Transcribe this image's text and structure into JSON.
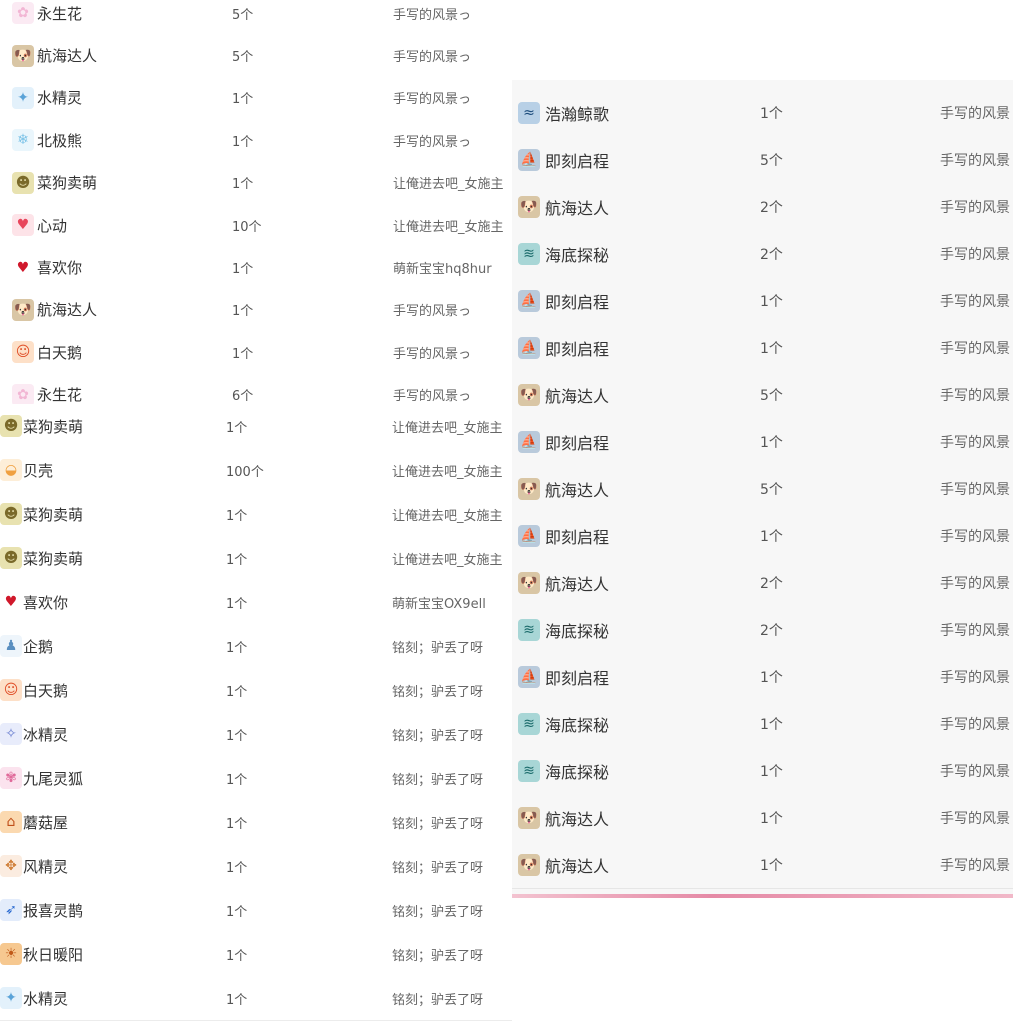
{
  "icons": {
    "永生花": {
      "glyph": "✿",
      "color": "#f2b6d4",
      "bg": "#fbeaf3",
      "name": "flower-icon"
    },
    "航海达人": {
      "glyph": "🐶",
      "color": "#6b4a2a",
      "bg": "#d9c6a5",
      "name": "pug-icon"
    },
    "水精灵": {
      "glyph": "✦",
      "color": "#5aa3d8",
      "bg": "#e3f1fb",
      "name": "water-sprite-icon"
    },
    "北极熊": {
      "glyph": "❄",
      "color": "#7ec4e8",
      "bg": "#eaf6fc",
      "name": "polar-bear-icon"
    },
    "菜狗卖萌": {
      "glyph": "☻",
      "color": "#7a6a2a",
      "bg": "#e8e2b0",
      "name": "dog-face-icon"
    },
    "心动": {
      "glyph": "♥",
      "color": "#e8465c",
      "bg": "#fde3e8",
      "name": "heartbeat-icon"
    },
    "喜欢你": {
      "glyph": "♥",
      "color": "#d0182b",
      "bg": "#ffffff",
      "name": "heart-icon"
    },
    "白天鹅": {
      "glyph": "☺",
      "color": "#e0502a",
      "bg": "#fde0c8",
      "name": "swan-icon"
    },
    "贝壳": {
      "glyph": "◒",
      "color": "#f0a040",
      "bg": "#fdeed8",
      "name": "shell-icon"
    },
    "企鹅": {
      "glyph": "♟",
      "color": "#5a8fc0",
      "bg": "#eef5fb",
      "name": "penguin-icon"
    },
    "冰精灵": {
      "glyph": "✧",
      "color": "#6a7fd0",
      "bg": "#e8ecfb",
      "name": "ice-sprite-icon"
    },
    "九尾灵狐": {
      "glyph": "✾",
      "color": "#e06a9a",
      "bg": "#fbe3ee",
      "name": "fox-icon"
    },
    "蘑菇屋": {
      "glyph": "⌂",
      "color": "#c0501a",
      "bg": "#fbd9b0",
      "name": "mushroom-house-icon"
    },
    "风精灵": {
      "glyph": "✥",
      "color": "#d0803a",
      "bg": "#fbece0",
      "name": "wind-sprite-icon"
    },
    "报喜灵鹊": {
      "glyph": "➶",
      "color": "#2a6ad0",
      "bg": "#e3ecfb",
      "name": "magpie-icon"
    },
    "秋日暖阳": {
      "glyph": "☀",
      "color": "#c05a1a",
      "bg": "#f6c890",
      "name": "autumn-sun-icon"
    },
    "浩瀚鲸歌": {
      "glyph": "≈",
      "color": "#1a4a7a",
      "bg": "#b8d0e6",
      "name": "whale-icon"
    },
    "即刻启程": {
      "glyph": "⛵",
      "color": "#2a4a6a",
      "bg": "#b9cadb",
      "name": "ship-icon"
    },
    "海底探秘": {
      "glyph": "≋",
      "color": "#1a6a6a",
      "bg": "#a8d6d6",
      "name": "seabed-icon"
    }
  },
  "panel_a": [
    {
      "name": "永生花",
      "count": "5个",
      "sender": "手写的风景っ"
    },
    {
      "name": "航海达人",
      "count": "5个",
      "sender": "手写的风景っ"
    },
    {
      "name": "水精灵",
      "count": "1个",
      "sender": "手写的风景っ"
    },
    {
      "name": "北极熊",
      "count": "1个",
      "sender": "手写的风景っ"
    },
    {
      "name": "菜狗卖萌",
      "count": "1个",
      "sender": "让俺进去吧_女施主"
    },
    {
      "name": "心动",
      "count": "10个",
      "sender": "让俺进去吧_女施主"
    },
    {
      "name": "喜欢你",
      "count": "1个",
      "sender": "萌新宝宝hq8hur"
    },
    {
      "name": "航海达人",
      "count": "1个",
      "sender": "手写的风景っ"
    },
    {
      "name": "白天鹅",
      "count": "1个",
      "sender": "手写的风景っ"
    },
    {
      "name": "永生花",
      "count": "6个",
      "sender": "手写的风景っ"
    }
  ],
  "panel_b": [
    {
      "name": "菜狗卖萌",
      "count": "1个",
      "sender": "让俺进去吧_女施主"
    },
    {
      "name": "贝壳",
      "count": "100个",
      "sender": "让俺进去吧_女施主"
    },
    {
      "name": "菜狗卖萌",
      "count": "1个",
      "sender": "让俺进去吧_女施主"
    },
    {
      "name": "菜狗卖萌",
      "count": "1个",
      "sender": "让俺进去吧_女施主"
    },
    {
      "name": "喜欢你",
      "count": "1个",
      "sender": "萌新宝宝OX9ell"
    },
    {
      "name": "企鹅",
      "count": "1个",
      "sender": "铭刻；驴丢了呀"
    },
    {
      "name": "白天鹅",
      "count": "1个",
      "sender": "铭刻；驴丢了呀"
    },
    {
      "name": "冰精灵",
      "count": "1个",
      "sender": "铭刻；驴丢了呀"
    },
    {
      "name": "九尾灵狐",
      "count": "1个",
      "sender": "铭刻；驴丢了呀"
    },
    {
      "name": "蘑菇屋",
      "count": "1个",
      "sender": "铭刻；驴丢了呀"
    },
    {
      "name": "风精灵",
      "count": "1个",
      "sender": "铭刻；驴丢了呀"
    },
    {
      "name": "报喜灵鹊",
      "count": "1个",
      "sender": "铭刻；驴丢了呀"
    },
    {
      "name": "秋日暖阳",
      "count": "1个",
      "sender": "铭刻；驴丢了呀"
    },
    {
      "name": "水精灵",
      "count": "1个",
      "sender": "铭刻；驴丢了呀"
    }
  ],
  "panel_c": [
    {
      "name": "浩瀚鲸歌",
      "count": "1个",
      "sender": "手写的风景"
    },
    {
      "name": "即刻启程",
      "count": "5个",
      "sender": "手写的风景"
    },
    {
      "name": "航海达人",
      "count": "2个",
      "sender": "手写的风景"
    },
    {
      "name": "海底探秘",
      "count": "2个",
      "sender": "手写的风景"
    },
    {
      "name": "即刻启程",
      "count": "1个",
      "sender": "手写的风景"
    },
    {
      "name": "即刻启程",
      "count": "1个",
      "sender": "手写的风景"
    },
    {
      "name": "航海达人",
      "count": "5个",
      "sender": "手写的风景"
    },
    {
      "name": "即刻启程",
      "count": "1个",
      "sender": "手写的风景"
    },
    {
      "name": "航海达人",
      "count": "5个",
      "sender": "手写的风景"
    },
    {
      "name": "即刻启程",
      "count": "1个",
      "sender": "手写的风景"
    },
    {
      "name": "航海达人",
      "count": "2个",
      "sender": "手写的风景"
    },
    {
      "name": "海底探秘",
      "count": "2个",
      "sender": "手写的风景"
    },
    {
      "name": "即刻启程",
      "count": "1个",
      "sender": "手写的风景"
    },
    {
      "name": "海底探秘",
      "count": "1个",
      "sender": "手写的风景"
    },
    {
      "name": "海底探秘",
      "count": "1个",
      "sender": "手写的风景"
    },
    {
      "name": "航海达人",
      "count": "1个",
      "sender": "手写的风景"
    },
    {
      "name": "航海达人",
      "count": "1个",
      "sender": "手写的风景"
    }
  ]
}
